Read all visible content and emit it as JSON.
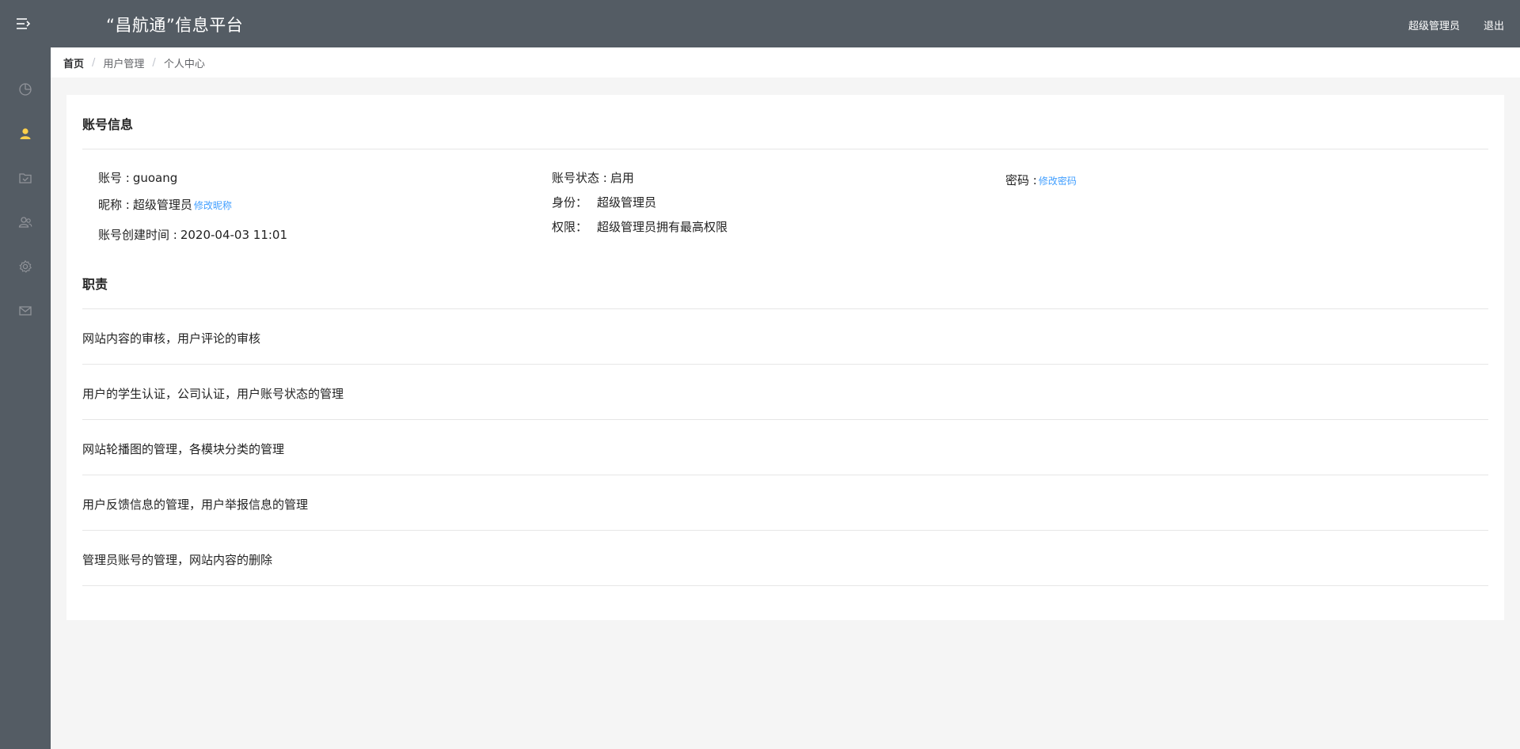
{
  "header": {
    "title": "“昌航通”信息平台",
    "user_role": "超级管理员",
    "logout": "退出"
  },
  "sidebar": {
    "items": [
      {
        "icon": "dashboard-icon",
        "active": false
      },
      {
        "icon": "user-icon",
        "active": true
      },
      {
        "icon": "folder-icon",
        "active": false
      },
      {
        "icon": "users-icon",
        "active": false
      },
      {
        "icon": "gear-icon",
        "active": false
      },
      {
        "icon": "mail-icon",
        "active": false
      }
    ],
    "active_color": "#ffd04b"
  },
  "breadcrumb": [
    "首页",
    "用户管理",
    "个人中心"
  ],
  "account": {
    "section_title": "账号信息",
    "username_label": "账号 :",
    "username": "guoang",
    "nickname_label": "昵称 :",
    "nickname": "超级管理员",
    "edit_nickname": "修改昵称",
    "created_label": "账号创建时间 :",
    "created": "2020-04-03 11:01",
    "status_label": "账号状态 :",
    "status": "启用",
    "identity_label": "身份：",
    "identity": "超级管理员",
    "permission_label": "权限：",
    "permission": "超级管理员拥有最高权限",
    "password_label": "密码 :",
    "edit_password": "修改密码"
  },
  "duties": {
    "section_title": "职责",
    "items": [
      "网站内容的审核，用户评论的审核",
      "用户的学生认证，公司认证，用户账号状态的管理",
      "网站轮播图的管理，各模块分类的管理",
      "用户反馈信息的管理，用户举报信息的管理",
      "管理员账号的管理，网站内容的删除"
    ]
  }
}
